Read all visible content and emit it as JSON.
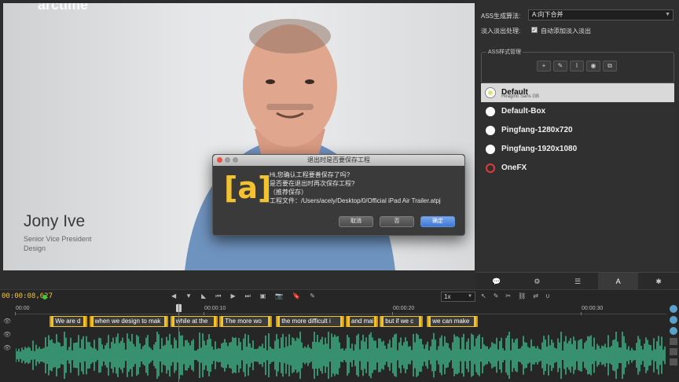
{
  "video": {
    "brand": "arctime",
    "lower_third": {
      "name": "Jony Ive",
      "role_line1": "Senior Vice President",
      "role_line2": "Design"
    }
  },
  "dialog": {
    "title": "退出时是否要保存工程",
    "logo": "[a]",
    "line1": "Hi,您确认工程要善保存了吗?",
    "line2": "是否要在退出时再次保存工程?",
    "line3": "（推荐保存）",
    "line4": "工程文件：/Users/acely/Desktop/0/Official iPad Air Trailer.atpj",
    "buttons": {
      "cancel": "取消",
      "no": "否",
      "ok": "确定"
    }
  },
  "right_panel": {
    "ass_algo_label": "ASS生成算法:",
    "ass_algo_value": "A:向下合并",
    "fade_label": "淡入淡出处理:",
    "fade_checkbox_label": "自动添加淡入淡出",
    "style_manage_title": "ASS样式管理",
    "style_tools": [
      "+",
      "✎",
      "I",
      "◉",
      "⧉"
    ],
    "styles": [
      {
        "name": "Default",
        "sub": "Hiragino Sans GB",
        "circle": "#e0e27a",
        "selected": true
      },
      {
        "name": "Default-Box",
        "sub": "",
        "circle": "#ffffff",
        "selected": false
      },
      {
        "name": "Pingfang-1280x720",
        "sub": "",
        "circle": "#ffffff",
        "selected": false
      },
      {
        "name": "Pingfang-1920x1080",
        "sub": "",
        "circle": "#ffffff",
        "selected": false
      },
      {
        "name": "OneFX",
        "sub": "",
        "circle": "#e03a3a",
        "selected": false
      }
    ],
    "tabs": [
      "💬",
      "⚙",
      "☰",
      "A",
      "✱"
    ]
  },
  "transport": {
    "timecode": "00:00:08,627",
    "controls": [
      "◀",
      "▼",
      "◣",
      "⏮",
      "▶",
      "⏭",
      "▣",
      "📷",
      "🔖",
      "✎"
    ],
    "speed": "1x",
    "edit_tools": [
      "↖",
      "✎",
      "✂",
      "⛓",
      "⇄",
      "∪"
    ]
  },
  "timeline": {
    "ticks": [
      {
        "label": "00:00",
        "t": 0
      },
      {
        "label": "00:00:10",
        "t": 10
      },
      {
        "label": "00:00:20",
        "t": 20
      },
      {
        "label": "00:00:30",
        "t": 30
      }
    ],
    "seconds_visible": 34.5,
    "playhead_t": 8.627,
    "subtitles": [
      {
        "text": "We are d",
        "start": 1.8,
        "end": 3.8
      },
      {
        "text": "when we design to mak",
        "start": 3.9,
        "end": 8.1
      },
      {
        "text": "while at the",
        "start": 8.2,
        "end": 10.7
      },
      {
        "text": "The more wo",
        "start": 10.8,
        "end": 13.6
      },
      {
        "text": "the more difficult i",
        "start": 13.8,
        "end": 17.4
      },
      {
        "text": "and mai",
        "start": 17.5,
        "end": 19.2
      },
      {
        "text": "but if we c",
        "start": 19.3,
        "end": 21.6
      },
      {
        "text": "we can make",
        "start": 21.8,
        "end": 24.5
      }
    ],
    "wave_color": "#3fbf8f"
  }
}
